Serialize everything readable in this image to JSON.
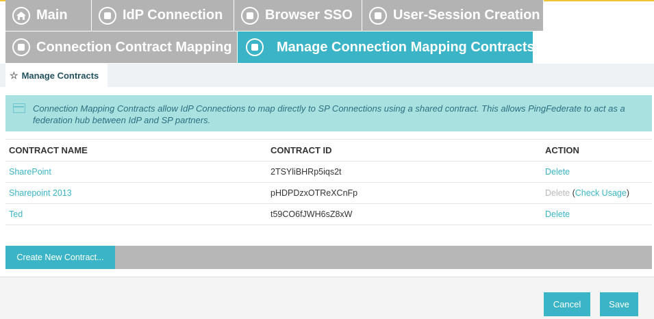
{
  "tabs_row1": [
    {
      "label": "Main",
      "icon": "home-icon"
    },
    {
      "label": "IdP Connection",
      "icon": "circle-square-icon"
    },
    {
      "label": "Browser SSO",
      "icon": "circle-square-icon"
    },
    {
      "label": "User-Session Creation",
      "icon": "circle-square-icon"
    }
  ],
  "tabs_row2": [
    {
      "label": "Connection Contract Mapping",
      "icon": "circle-square-icon"
    },
    {
      "label": "Manage Connection Mapping Contracts",
      "icon": "circle-square-icon",
      "active": true
    }
  ],
  "subnav": {
    "label": "Manage Contracts",
    "icon": "star-icon"
  },
  "info": {
    "text": "Connection Mapping Contracts allow IdP Connections to map directly to SP Connections using a shared contract. This allows PingFederate to act as a federation hub between IdP and SP partners."
  },
  "table": {
    "headers": [
      "CONTRACT NAME",
      "CONTRACT ID",
      "ACTION"
    ],
    "rows": [
      {
        "name": "SharePoint",
        "id": "2TSYliBHRp5iqs2t",
        "action": "Delete",
        "action_enabled": true,
        "extra": ""
      },
      {
        "name": "Sharepoint 2013",
        "id": "pHDPDzxOTReXCnFp",
        "action": "Delete",
        "action_enabled": false,
        "extra_open": " (",
        "extra": "Check Usage",
        "extra_close": ")"
      },
      {
        "name": "Ted",
        "id": "t59CO6fJWH6sZ8xW",
        "action": "Delete",
        "action_enabled": true,
        "extra": ""
      }
    ]
  },
  "create_button": "Create New Contract...",
  "footer": {
    "cancel": "Cancel",
    "save": "Save"
  },
  "colors": {
    "accent": "#3ab4c6",
    "tab_inactive": "#b3b3b3",
    "info_bg": "#a9e1e1",
    "top_line": "#f1c232"
  }
}
